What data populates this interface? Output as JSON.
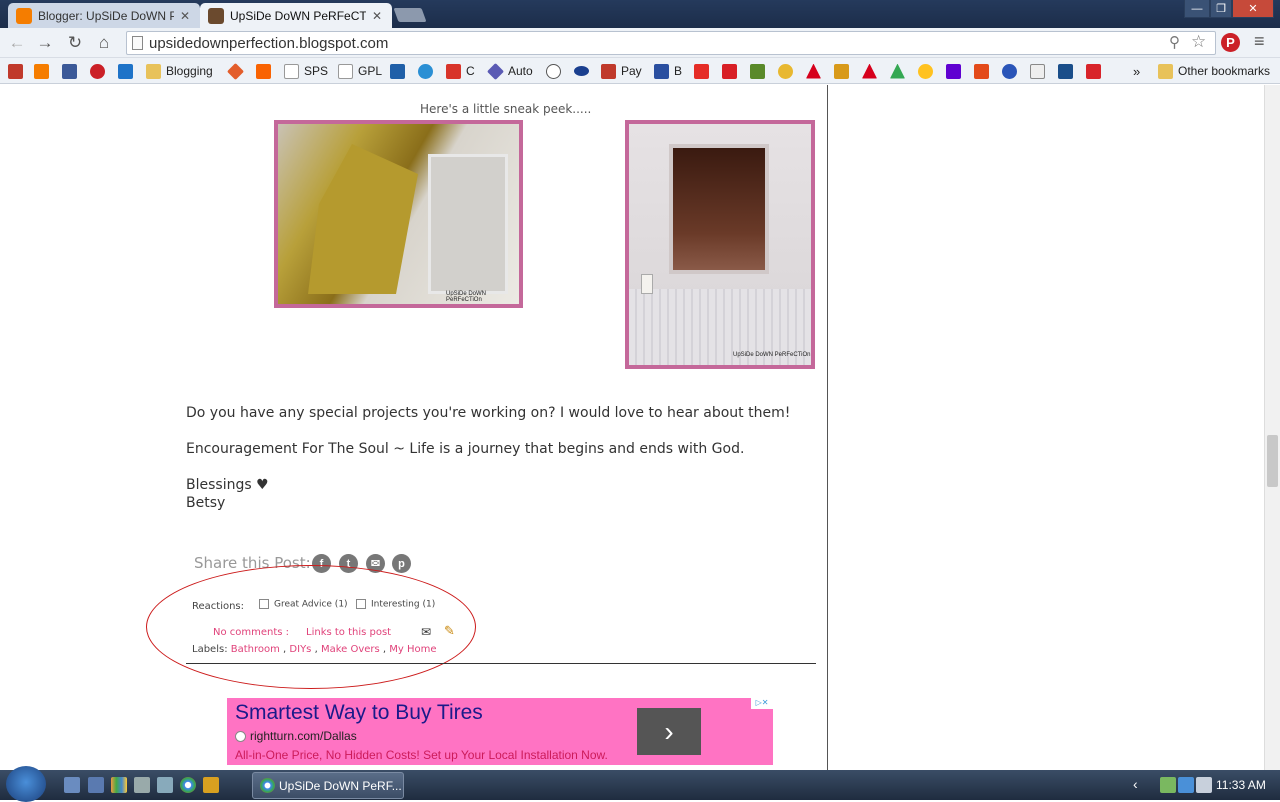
{
  "browser": {
    "tabs": [
      {
        "title": "Blogger: UpSiDe DoWN Pe",
        "favicon_color": "#f57d00"
      },
      {
        "title": "UpSiDe DoWN PeRFeCTio",
        "favicon_color": "#6b4a2e"
      }
    ],
    "url": "upsidedownperfection.blogspot.com",
    "window_controls": {
      "minimize": "—",
      "maximize": "❐",
      "close": "✕"
    }
  },
  "bookmarks": {
    "items": [
      "Blogging",
      "SPS",
      "GPL",
      "C",
      "Auto",
      "Pay",
      "B"
    ],
    "overflow": "»",
    "other": "Other bookmarks"
  },
  "post": {
    "sneak_peek": "Here's a little sneak peek.....",
    "watermark": "UpSiDe DoWN PeRFeCTiOn",
    "paragraph1": "Do you have any special projects you're working on?  I would love to hear about them!",
    "paragraph2": "Encouragement For The Soul ~ Life is a journey that begins and ends with God.",
    "signoff": "Blessings ♥",
    "signature": "Betsy",
    "share_label": "Share this Post:",
    "reactions_label": "Reactions:",
    "reactions": [
      "Great Advice (1)",
      "Interesting (1)"
    ],
    "comments_link": "No comments :",
    "links_to_post": "Links to this post",
    "labels_label": "Labels:",
    "labels": [
      "Bathroom",
      "DIYs",
      "Make Overs",
      "My Home"
    ]
  },
  "ad": {
    "headline": "Smartest Way to Buy Tires",
    "domain": "rightturn.com/Dallas",
    "description": "All-in-One Price, No Hidden Costs! Set up Your Local Installation Now."
  },
  "taskbar": {
    "app_title": "UpSiDe DoWN PeRF...",
    "clock": "11:33 AM"
  },
  "colors": {
    "accent_pink": "#e0427a",
    "photo_border": "#c4689a",
    "annotation_red": "#cc1b1b",
    "ad_bg": "#ff73c3"
  }
}
